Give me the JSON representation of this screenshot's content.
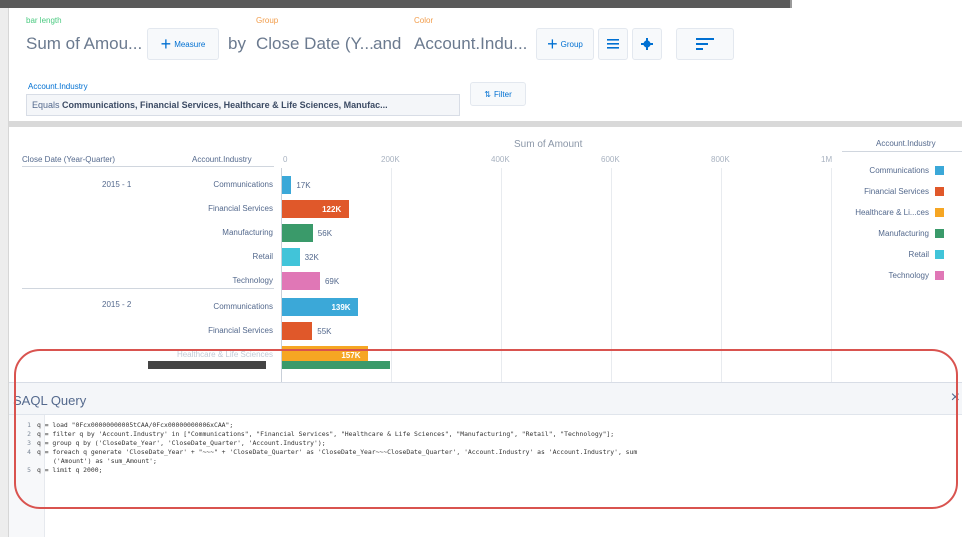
{
  "query_bar": {
    "bar_length_label": "bar length",
    "group_label": "Group",
    "color_label": "Color",
    "measure_value": "Sum of Amou...",
    "measure_button": "Measure",
    "by_text": "by",
    "group_value": "Close Date (Y...",
    "and_text": "and",
    "color_value": "Account.Indu...",
    "group_button": "Group"
  },
  "filter": {
    "title": "Account.Industry",
    "prefix": "Equals",
    "value": "Communications, Financial Services, Healthcare & Life Sciences, Manufac...",
    "button": "Filter"
  },
  "chart_data": {
    "type": "bar",
    "title": "Sum of Amount",
    "row_headers": [
      "Close Date (Year-Quarter)",
      "Account.Industry"
    ],
    "x_ticks": [
      "0",
      "200K",
      "400K",
      "600K",
      "800K",
      "1M"
    ],
    "xlim": [
      0,
      1000000
    ],
    "groups": [
      {
        "quarter": "2015 - 1",
        "bars": [
          {
            "category": "Communications",
            "value": 17000,
            "label": "17K"
          },
          {
            "category": "Financial Services",
            "value": 122000,
            "label": "122K"
          },
          {
            "category": "Manufacturing",
            "value": 56000,
            "label": "56K"
          },
          {
            "category": "Retail",
            "value": 32000,
            "label": "32K"
          },
          {
            "category": "Technology",
            "value": 69000,
            "label": "69K"
          }
        ]
      },
      {
        "quarter": "2015 - 2",
        "bars": [
          {
            "category": "Communications",
            "value": 139000,
            "label": "139K"
          },
          {
            "category": "Financial Services",
            "value": 55000,
            "label": "55K"
          },
          {
            "category": "Healthcare & Life Sciences",
            "value": 157000,
            "label": "157K"
          }
        ]
      }
    ],
    "legend": {
      "title": "Account.Industry",
      "items": [
        {
          "name": "Communications",
          "color": "#3ba8d8"
        },
        {
          "name": "Financial Services",
          "color": "#e0582a"
        },
        {
          "name": "Healthcare & Li...ces",
          "color": "#f6a623"
        },
        {
          "name": "Manufacturing",
          "color": "#3a9a6a"
        },
        {
          "name": "Retail",
          "color": "#41c4d9"
        },
        {
          "name": "Technology",
          "color": "#e077b6"
        }
      ]
    }
  },
  "colors": {
    "Communications": "#3ba8d8",
    "Financial Services": "#e0582a",
    "Healthcare & Life Sciences": "#f6a623",
    "Manufacturing": "#3a9a6a",
    "Retail": "#41c4d9",
    "Technology": "#e077b6"
  },
  "saql": {
    "title": "SAQL Query",
    "close": "×",
    "lines": [
      {
        "num": "1",
        "text": "q = load \"0Fcx00000000005tCAA/0Fcx00000000006xCAA\";"
      },
      {
        "num": "2",
        "text": "q = filter q by 'Account.Industry' in [\"Communications\", \"Financial Services\", \"Healthcare & Life Sciences\", \"Manufacturing\", \"Retail\", \"Technology\"];"
      },
      {
        "num": "3",
        "text": "q = group q by ('CloseDate_Year', 'CloseDate_Quarter', 'Account.Industry');"
      },
      {
        "num": "4",
        "text": "q = foreach q generate 'CloseDate_Year' + \"~~~\" + 'CloseDate_Quarter' as 'CloseDate_Year~~~CloseDate_Quarter', 'Account.Industry' as 'Account.Industry', sum"
      },
      {
        "num": "",
        "text": "('Amount') as 'sum_Amount';"
      },
      {
        "num": "5",
        "text": "q = limit q 2000;"
      }
    ]
  }
}
